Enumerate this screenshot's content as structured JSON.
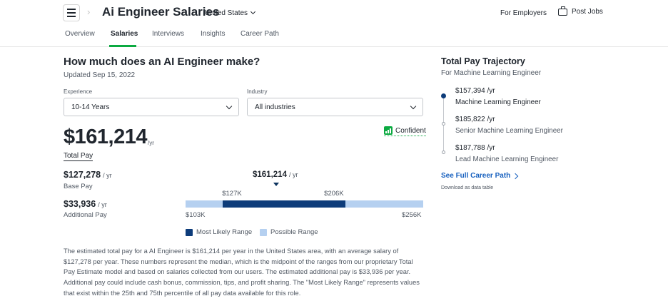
{
  "header": {
    "title": "Ai Engineer Salaries",
    "country": "United States",
    "for_employers": "For Employers",
    "post_jobs": "Post Jobs"
  },
  "tabs": [
    {
      "label": "Overview",
      "active": false
    },
    {
      "label": "Salaries",
      "active": true
    },
    {
      "label": "Interviews",
      "active": false
    },
    {
      "label": "Insights",
      "active": false
    },
    {
      "label": "Career Path",
      "active": false
    }
  ],
  "main": {
    "heading": "How much does an AI Engineer make?",
    "updated": "Updated Sep 15, 2022",
    "experience": {
      "label": "Experience",
      "value": "10-14 Years"
    },
    "industry": {
      "label": "Industry",
      "value": "All industries"
    },
    "confidence": "Confident",
    "total_pay": {
      "amount": "$161,214",
      "unit": "/yr",
      "label": "Total Pay"
    },
    "base_pay": {
      "amount": "$127,278",
      "unit": "/ yr",
      "label": "Base Pay"
    },
    "additional_pay": {
      "amount": "$33,936",
      "unit": "/ yr",
      "label": "Additional Pay"
    },
    "description": "The estimated total pay for a AI Engineer is $161,214 per year in the United States area, with an average salary of $127,278 per year. These numbers represent the median, which is the midpoint of the ranges from our proprietary Total Pay Estimate model and based on salaries collected from our users. The estimated additional pay is $33,936 per year. Additional pay could include cash bonus, commission, tips, and profit sharing. The \"Most Likely Range\" represents values that exist within the 25th and 75th percentile of all pay data available for this role."
  },
  "range": {
    "median": {
      "value": 161214,
      "label": "$161,214",
      "unit": "/ yr"
    },
    "possible": {
      "min": 103000,
      "max": 256000,
      "min_label": "$103K",
      "max_label": "$256K"
    },
    "likely": {
      "min": 127000,
      "max": 206000,
      "min_label": "$127K",
      "max_label": "$206K"
    },
    "legend": {
      "likely": "Most Likely Range",
      "possible": "Possible Range"
    },
    "colors": {
      "likely": "#0d3c7a",
      "possible": "#b5d0f0",
      "median_marker": "#0d345f"
    }
  },
  "trajectory": {
    "title": "Total Pay Trajectory",
    "subtitle": "For Machine Learning Engineer",
    "items": [
      {
        "salary": "$157,394 /yr",
        "role": "Machine Learning Engineer",
        "current": true
      },
      {
        "salary": "$185,822 /yr",
        "role": "Senior Machine Learning Engineer",
        "current": false
      },
      {
        "salary": "$187,788 /yr",
        "role": "Lead Machine Learning Engineer",
        "current": false
      }
    ],
    "see_full": "See Full Career Path",
    "download": "Download as data table"
  },
  "colors": {
    "accent_green": "#0caa41",
    "link_blue": "#1861bf",
    "text_dark": "#20262e",
    "text_muted": "#505863"
  },
  "icons": {
    "menu": "hamburger-icon",
    "post_jobs": "briefcase-icon",
    "confidence": "bar-chart-icon",
    "see_full": "chevron-right-icon"
  }
}
